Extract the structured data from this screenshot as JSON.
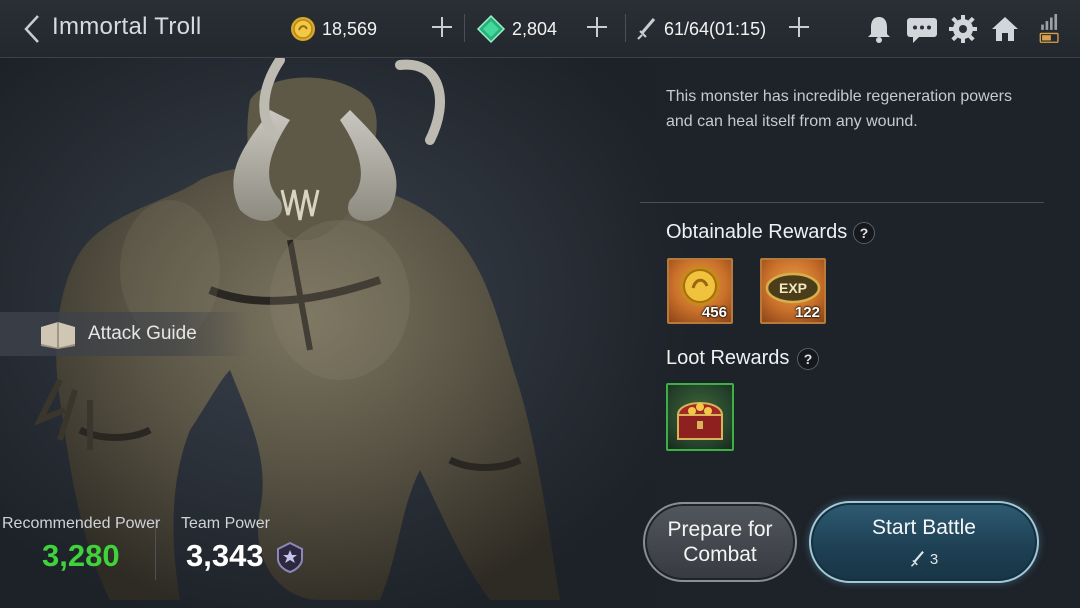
{
  "header": {
    "title": "Immortal Troll",
    "gold": "18,569",
    "gems": "2,804",
    "stamina": "61/64(01:15)"
  },
  "description": "This monster has incredible regeneration powers and can heal itself from any wound.",
  "attack_guide": {
    "label": "Attack Guide"
  },
  "power": {
    "recommended_label": "Recommended Power",
    "recommended_value": "3,280",
    "team_label": "Team Power",
    "team_value": "3,343"
  },
  "rewards": {
    "obtainable_title": "Obtainable Rewards",
    "items": [
      {
        "icon": "gold-coin-icon",
        "count": "456"
      },
      {
        "icon": "exp-icon",
        "label": "EXP",
        "count": "122"
      }
    ],
    "loot_title": "Loot Rewards",
    "loot_items": [
      {
        "icon": "treasure-chest-icon"
      }
    ]
  },
  "buttons": {
    "prepare_line1": "Prepare for",
    "prepare_line2": "Combat",
    "start_label": "Start Battle",
    "start_cost": "3"
  },
  "colors": {
    "recommended_power": "#3fd23a",
    "team_power": "#ffffff",
    "start_button_border": "#9fc8da",
    "loot_border": "#3bb043"
  },
  "top_icons": [
    "bell-icon",
    "chat-icon",
    "gear-icon",
    "home-icon",
    "signal-battery-icon"
  ]
}
